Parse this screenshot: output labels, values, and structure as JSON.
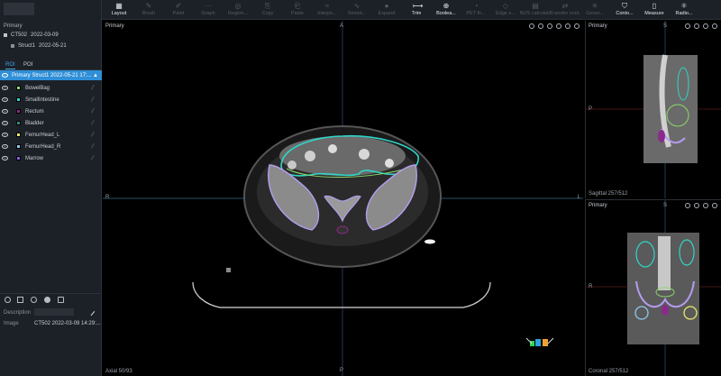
{
  "sidebar": {
    "plan_label": "Primary",
    "study": {
      "name": "CT502",
      "date": "2022-03-09"
    },
    "struct": {
      "name": "Struct1",
      "date": "2022-05-21"
    },
    "tabs": [
      "ROI",
      "POI"
    ],
    "struct_header": "Primary Struct1 2022-05-21 17:...",
    "rois": [
      {
        "name": "BowelBag",
        "color": "#8dd76a"
      },
      {
        "name": "SmallIntestine",
        "color": "#2fd6c8"
      },
      {
        "name": "Rectum",
        "color": "#8a2a8c"
      },
      {
        "name": "Bladder",
        "color": "#2e8a78"
      },
      {
        "name": "FemurHead_L",
        "color": "#e8e86a"
      },
      {
        "name": "FemurHead_R",
        "color": "#8ec8f0"
      },
      {
        "name": "Marrow",
        "color": "#8a5ce0"
      }
    ],
    "description_label": "Description",
    "image_label": "Image",
    "image_value": "CT502 2022-03-09 14:29:..."
  },
  "toolbar": {
    "items": [
      {
        "label": "Layout",
        "icon": "layout-icon",
        "state": "bright"
      },
      {
        "label": "Brush",
        "icon": "brush-icon",
        "state": "dim"
      },
      {
        "label": "Paint",
        "icon": "paint-icon",
        "state": "dim"
      },
      {
        "label": "Graph",
        "icon": "graph-icon",
        "state": "dim"
      },
      {
        "label": "Region...",
        "icon": "region-icon",
        "state": "dim"
      },
      {
        "label": "Copy",
        "icon": "copy-icon",
        "state": "dim"
      },
      {
        "label": "Paste",
        "icon": "paste-icon",
        "state": "dim"
      },
      {
        "label": "Interpo...",
        "icon": "interpolate-icon",
        "state": "dim"
      },
      {
        "label": "Smoot...",
        "icon": "smooth-icon",
        "state": "dim"
      },
      {
        "label": "Expand",
        "icon": "expand-icon",
        "state": "dim"
      },
      {
        "label": "Trim",
        "icon": "trim-icon",
        "state": "bright"
      },
      {
        "label": "Boolea...",
        "icon": "boolean-icon",
        "state": "bright"
      },
      {
        "label": "PET th...",
        "icon": "pet-icon",
        "state": "dim"
      },
      {
        "label": "Edge s...",
        "icon": "edge-icon",
        "state": "dim"
      },
      {
        "label": "BUS calculation",
        "icon": "bus-icon",
        "state": "dim"
      },
      {
        "label": "Transfer cont...",
        "icon": "transfer-icon",
        "state": "dim"
      },
      {
        "label": "Gener...",
        "icon": "generate-icon",
        "state": "dim"
      },
      {
        "label": "Conto...",
        "icon": "contour-icon",
        "state": "bright"
      },
      {
        "label": "Measure",
        "icon": "measure-icon",
        "state": "bright"
      },
      {
        "label": "Radio...",
        "icon": "radiomics-icon",
        "state": "bright"
      }
    ]
  },
  "viewports": {
    "axial": {
      "title": "Primary",
      "footer": "Axial 50/93",
      "orient_top": "A",
      "orient_bottom": "P",
      "orient_left": "R",
      "orient_right": "L"
    },
    "sagittal": {
      "title": "Primary",
      "footer": "Sagittal 257/512",
      "orient_top": "S",
      "orient_left": "P"
    },
    "coronal": {
      "title": "Primary",
      "footer": "Coronal 257/512",
      "orient_top": "S",
      "orient_left": "R"
    }
  }
}
